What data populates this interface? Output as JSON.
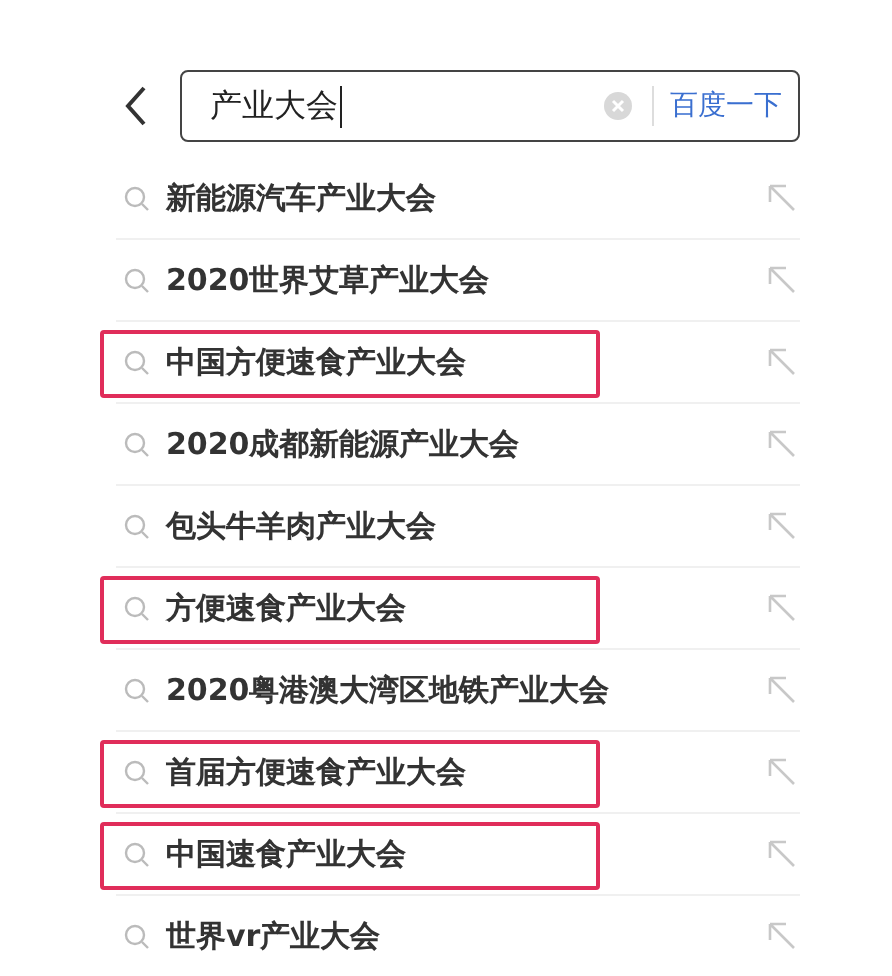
{
  "search": {
    "value": "产业大会",
    "button": "百度一下"
  },
  "suggestions": [
    {
      "text": "新能源汽车产业大会",
      "highlighted": false
    },
    {
      "text": "2020世界艾草产业大会",
      "highlighted": false
    },
    {
      "text": "中国方便速食产业大会",
      "highlighted": true
    },
    {
      "text": "2020成都新能源产业大会",
      "highlighted": false
    },
    {
      "text": "包头牛羊肉产业大会",
      "highlighted": false
    },
    {
      "text": "方便速食产业大会",
      "highlighted": true
    },
    {
      "text": "2020粤港澳大湾区地铁产业大会",
      "highlighted": false
    },
    {
      "text": "首届方便速食产业大会",
      "highlighted": true
    },
    {
      "text": "中国速食产业大会",
      "highlighted": true
    },
    {
      "text": "世界vr产业大会",
      "highlighted": false
    }
  ]
}
